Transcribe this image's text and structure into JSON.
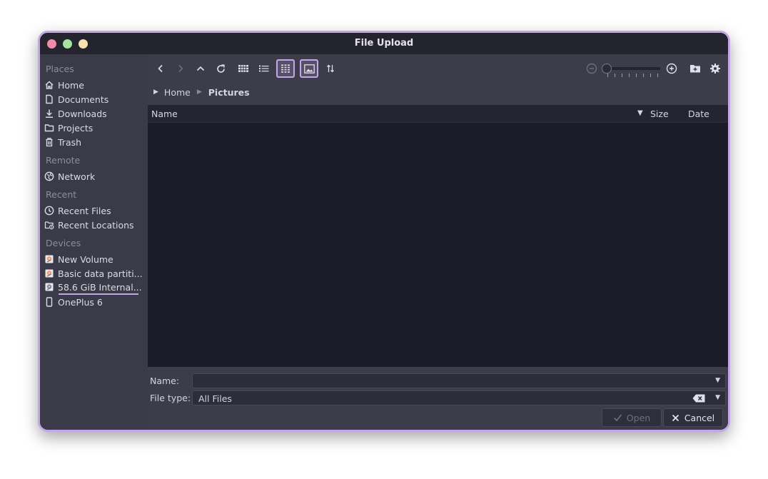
{
  "window": {
    "title": "File Upload"
  },
  "sidebar": {
    "sections": [
      {
        "heading": "Places",
        "items": [
          {
            "label": "Home",
            "icon": "home-icon"
          },
          {
            "label": "Documents",
            "icon": "document-icon"
          },
          {
            "label": "Downloads",
            "icon": "download-icon"
          },
          {
            "label": "Projects",
            "icon": "folder-icon"
          },
          {
            "label": "Trash",
            "icon": "trash-icon"
          }
        ]
      },
      {
        "heading": "Remote",
        "items": [
          {
            "label": "Network",
            "icon": "network-icon"
          }
        ]
      },
      {
        "heading": "Recent",
        "items": [
          {
            "label": "Recent Files",
            "icon": "clock-icon"
          },
          {
            "label": "Recent Locations",
            "icon": "recent-folder-icon"
          }
        ]
      },
      {
        "heading": "Devices",
        "items": [
          {
            "label": "New Volume",
            "icon": "drive-icon"
          },
          {
            "label": "Basic data partiti...",
            "icon": "drive-icon"
          },
          {
            "label": "58.6 GiB Internal...",
            "icon": "drive-icon"
          },
          {
            "label": "OnePlus 6",
            "icon": "phone-icon"
          }
        ]
      }
    ]
  },
  "breadcrumb": {
    "items": [
      "Home",
      "Pictures"
    ]
  },
  "filelist": {
    "columns": {
      "name": "Name",
      "size": "Size",
      "date": "Date"
    }
  },
  "form": {
    "name_label": "Name:",
    "name_value": "",
    "filetype_label": "File type:",
    "filetype_value": "All Files"
  },
  "buttons": {
    "open": "Open",
    "cancel": "Cancel"
  },
  "colors": {
    "accent": "#c4a7e7",
    "sidebar_bg": "#3a3a48",
    "list_bg": "#1c1c28"
  }
}
